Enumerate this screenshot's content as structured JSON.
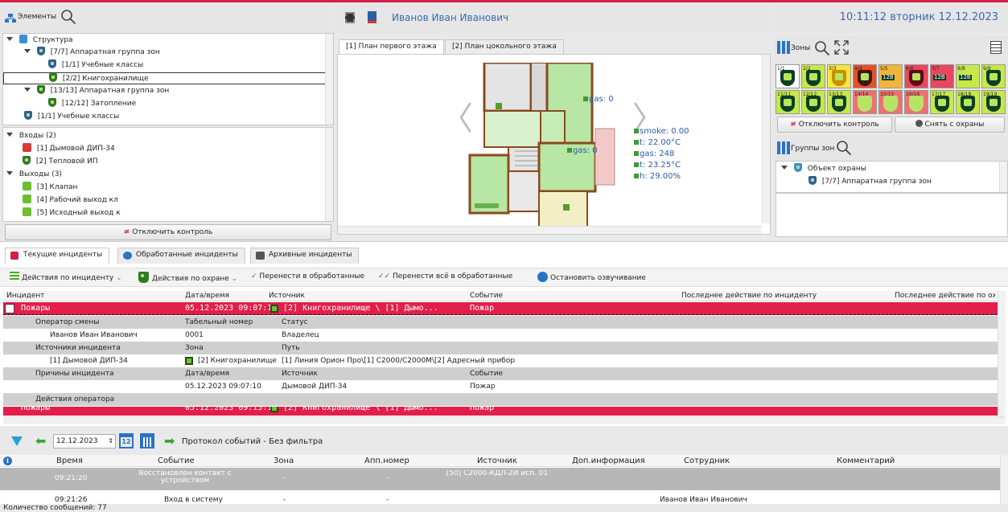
{
  "header": {
    "elements_title": "Элементы",
    "user_name": "Иванов Иван Иванович",
    "datetime": "10:11:12 вторник 12.12.2023",
    "accent_color": "#d21f46"
  },
  "tree": {
    "items": [
      {
        "label": "Структура"
      },
      {
        "label": "[7/7] Аппаратная группа зон"
      },
      {
        "label": "[1/1] Учебные классы"
      },
      {
        "label": "[2/2] Книгохранилище"
      },
      {
        "label": "[13/13] Аппаратная группа зон"
      },
      {
        "label": "[12/12] Затопление"
      },
      {
        "label": "[1/1] Учебные классы"
      }
    ]
  },
  "io": {
    "inputs_label": "Входы (2)",
    "inputs": [
      "[1] Дымовой ДИП-34",
      "[2] Тепловой ИП"
    ],
    "outputs_label": "Выходы (3)",
    "outputs": [
      "[3] Клапан",
      "[4] Рабочий выход кл",
      "[5] Исходный выход к"
    ],
    "disable_control": "Отключить контроль"
  },
  "plan": {
    "tabs": [
      "[1] План первого этажа",
      "[2] План цокольного этажа"
    ],
    "labels": {
      "gas1": "gas: 0",
      "gas2": "gas: 0",
      "smoke": "smoke: 0.00",
      "t1": "t: 22.00°C",
      "gas3": "gas: 248",
      "t2": "t: 23.25°C",
      "h": "h: 29.00%"
    }
  },
  "zones": {
    "title": "Зоны",
    "tiles_row1": [
      "1/1",
      "2/2",
      "3/3",
      "4/4",
      "5/5",
      "6/6",
      "7/7",
      "8/8",
      "9/9",
      "10/10"
    ],
    "tiles_row2": [
      "11/11",
      "12/12",
      "13/13",
      "14/14",
      "15/15",
      "16/16",
      "17/17",
      "18/18",
      "19/19",
      "20/20"
    ],
    "tile_badges": [
      "",
      "",
      "",
      "",
      "12B",
      "",
      "12B",
      "12B",
      "",
      ""
    ],
    "disable_control": "Отключить контроль",
    "disarm": "Снять с охраны",
    "groups_title": "Группы зон",
    "groups": [
      "Объект охраны",
      "[7/7] Аппаратная группа зон"
    ]
  },
  "incidents": {
    "tabs": [
      "Текущие инциденты",
      "Обработанные инциденты",
      "Архивные инциденты"
    ],
    "toolbar": {
      "incident_actions": "Действия по инциденту",
      "guard_actions": "Действия по охране",
      "move_processed": "Перенести в обработанные",
      "move_all_processed": "Перенести всё в обработанные",
      "stop_sound": "Остановить озвучивание"
    },
    "columns": [
      "Инцидент",
      "Дата/время",
      "Источник",
      "Событие",
      "Последнее действие по инциденту",
      "Последнее действие по ох"
    ],
    "main": {
      "name": "Пожары",
      "datetime": "05.12.2023 09:07:10",
      "source": "[2] Книгохранилище \\ [1] Дымо...",
      "event": "Пожар"
    },
    "operator_header": [
      "Оператор смены",
      "Табельный номер",
      "Статус"
    ],
    "operator": [
      "Иванов Иван Иванович",
      "0001",
      "Владелец"
    ],
    "sources_header": [
      "Источники инцидента",
      "Зона",
      "Путь"
    ],
    "sources": [
      "[1] Дымовой ДИП-34",
      "[2] Книгохранилище",
      "[1] Линия Орион Про\\[1] С2000/С2000М\\[2] Адресный прибор"
    ],
    "causes_header": [
      "Причины инцидента",
      "Дата/время",
      "Источник",
      "Событие"
    ],
    "causes": [
      "05.12.2023 09:07:10",
      "Дымовой ДИП-34",
      "Пожар"
    ],
    "actions_header": "Действия оператора",
    "second": {
      "name": "Пожары",
      "datetime": "05.12.2023 09:15:11",
      "source": "[2] Книгохранилище \\ [1] Дымо...",
      "event": "Пожар"
    }
  },
  "protocol": {
    "date": "12.12.2023",
    "title": "Протокол событий - Без фильтра",
    "columns": [
      "Время",
      "Событие",
      "Зона",
      "Апп.номер",
      "Источник",
      "Доп.информация",
      "Сотрудник",
      "Комментарий"
    ],
    "rows": [
      {
        "time": "09:21:20",
        "event": "Восстановлен контакт с устройством",
        "zone": "-",
        "app": "-",
        "source": "[50] С2000-КДЛ-2И исп. 01",
        "info": "",
        "employee": "",
        "comment": ""
      },
      {
        "time": "09:21:26",
        "event": "Вход в систему",
        "zone": "-",
        "app": "-",
        "source": "",
        "info": "",
        "employee": "Иванов Иван Иванович",
        "comment": ""
      }
    ],
    "count": "Количество сообщений: 77"
  }
}
